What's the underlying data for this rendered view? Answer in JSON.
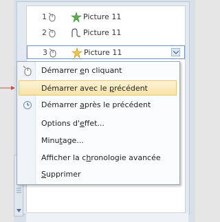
{
  "animation_list": {
    "items": [
      {
        "number": "1",
        "label": "Picture 11",
        "effect_icon": "star-burst-icon"
      },
      {
        "number": "2",
        "label": "Picture 11",
        "effect_icon": "motion-path-icon"
      },
      {
        "number": "3",
        "label": "Picture 11",
        "effect_icon": "spin-star-icon",
        "selected": true
      }
    ]
  },
  "context_menu": {
    "items": [
      {
        "before": "Démarrer ",
        "u": "e",
        "after": "n cliquant",
        "icon": "mouse-click-icon"
      },
      {
        "before": "Démarrer avec le ",
        "u": "p",
        "after": "récédent",
        "highlighted": true
      },
      {
        "before": "Démarrer ",
        "u": "a",
        "after": "près le précédent",
        "icon": "clock-icon"
      },
      {
        "before": "Options d'",
        "u": "e",
        "after": "ffet..."
      },
      {
        "before": "Minu",
        "u": "t",
        "after": "age..."
      },
      {
        "before": "Afficher la c",
        "u": "h",
        "after": "ronologie avancée"
      },
      {
        "before": "",
        "u": "S",
        "after": "upprimer"
      }
    ]
  },
  "colors": {
    "highlight": "#f8e3a7",
    "selection_border": "#6e93c3",
    "pointer_arrow": "#c0504d"
  }
}
